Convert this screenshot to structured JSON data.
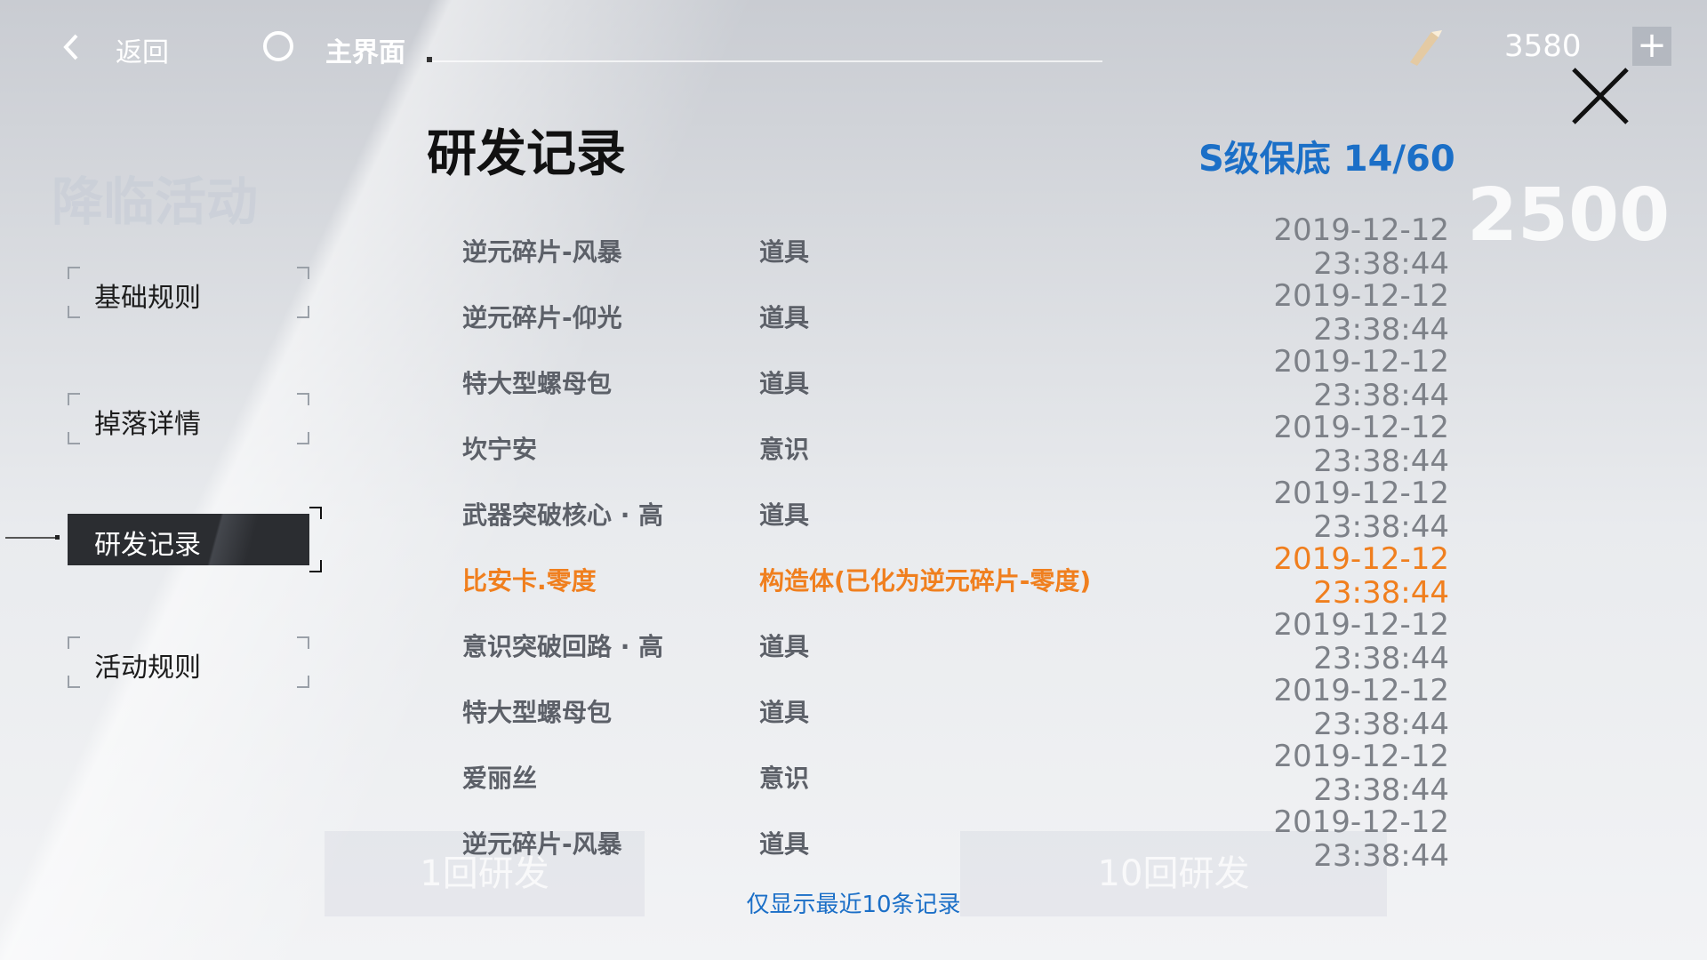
{
  "topbar": {
    "back_label": "返回",
    "home_label": "主界面",
    "currency_value": "3580",
    "plus_label": "+"
  },
  "background": {
    "title": "降临活动",
    "big_number": "2500",
    "button1": "1回研发",
    "button2": "10回研发"
  },
  "sidebar": {
    "items": [
      {
        "label": "基础规则"
      },
      {
        "label": "掉落详情"
      },
      {
        "label": "研发记录"
      },
      {
        "label": "活动规则"
      }
    ]
  },
  "panel": {
    "title": "研发记录",
    "pity": "S级保底 14/60",
    "footer": "仅显示最近10条记录",
    "records": [
      {
        "name": "逆元碎片-风暴",
        "type": "道具",
        "date": "2019-12-12",
        "time": "23:38:44"
      },
      {
        "name": "逆元碎片-仰光",
        "type": "道具",
        "date": "2019-12-12",
        "time": "23:38:44"
      },
      {
        "name": "特大型螺母包",
        "type": "道具",
        "date": "2019-12-12",
        "time": "23:38:44"
      },
      {
        "name": "坎宁安",
        "type": "意识",
        "date": "2019-12-12",
        "time": "23:38:44"
      },
      {
        "name": "武器突破核心 · 高",
        "type": "道具",
        "date": "2019-12-12",
        "time": "23:38:44"
      },
      {
        "name": "比安卡.零度",
        "type": "构造体(已化为逆元碎片-零度)",
        "date": "2019-12-12",
        "time": "23:38:44"
      },
      {
        "name": "意识突破回路 · 高",
        "type": "道具",
        "date": "2019-12-12",
        "time": "23:38:44"
      },
      {
        "name": "特大型螺母包",
        "type": "道具",
        "date": "2019-12-12",
        "time": "23:38:44"
      },
      {
        "name": "爱丽丝",
        "type": "意识",
        "date": "2019-12-12",
        "time": "23:38:44"
      },
      {
        "name": "逆元碎片-风暴",
        "type": "道具",
        "date": "2019-12-12",
        "time": "23:38:44"
      }
    ]
  },
  "colors": {
    "accent_blue": "#1b6fc7",
    "highlight_orange": "#f07f1e"
  }
}
